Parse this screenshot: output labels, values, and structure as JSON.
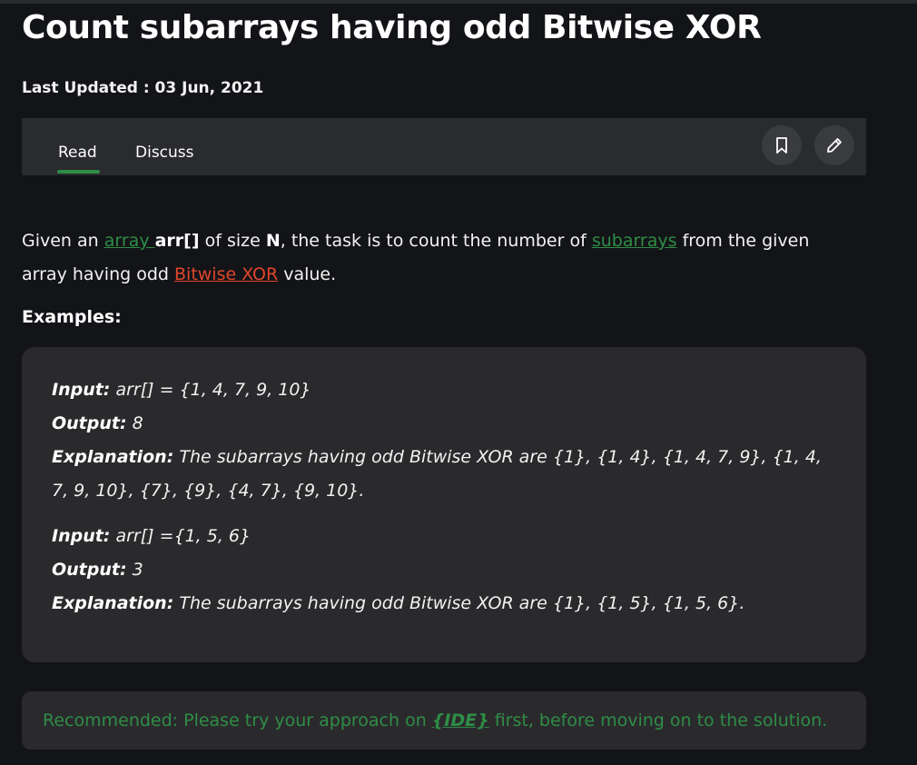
{
  "article": {
    "title": "Count subarrays having odd Bitwise XOR",
    "last_updated": "Last Updated : 03 Jun, 2021"
  },
  "tabs": {
    "read": "Read",
    "discuss": "Discuss"
  },
  "toolbar": {
    "bookmark_icon": "bookmark-icon",
    "edit_icon": "pencil-icon"
  },
  "intro": {
    "t1": "Given an ",
    "link_array": "array ",
    "bold_arr": "arr[]",
    "t2": " of size ",
    "bold_n": "N",
    "t3": ", the task is to count the number of ",
    "link_subarrays": "subarrays",
    "t4": " from the given array having odd ",
    "link_xor": "Bitwise XOR",
    "t5": " value."
  },
  "examples_heading": "Examples:",
  "examples": [
    {
      "input_label": "Input:",
      "input_value": " arr[] = {1, 4, 7, 9, 10}",
      "output_label": "Output:",
      "output_value": " 8",
      "explanation_label": "Explanation:",
      "explanation_value": " The subarrays having odd Bitwise XOR are {1}, {1, 4}, {1, 4, 7, 9}, {1, 4, 7, 9, 10}, {7}, {9}, {4, 7}, {9, 10}."
    },
    {
      "input_label": "Input:",
      "input_value": " arr[] ={1, 5, 6}",
      "output_label": "Output:",
      "output_value": " 3",
      "explanation_label": "Explanation:",
      "explanation_value": " The subarrays having odd Bitwise XOR are {1}, {1, 5}, {1, 5, 6}."
    }
  ],
  "recommended": {
    "prefix": "Recommended: Please try your approach on ",
    "ide_link": "{IDE}",
    "suffix": " first, before moving on to the solution."
  },
  "colors": {
    "background": "#131417",
    "panel": "#2a2a2d",
    "accent_green": "#2f8d46",
    "link_red": "#e0452c"
  }
}
